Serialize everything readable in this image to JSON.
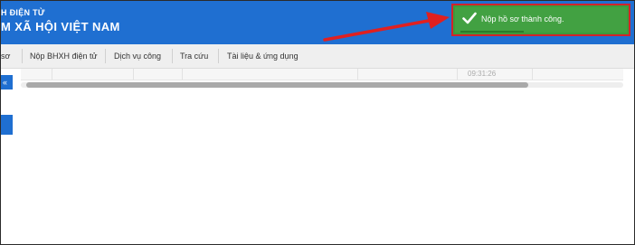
{
  "header": {
    "brand_line1": "H ĐIỆN TỬ",
    "brand_line2": "M XÃ HỘI VIỆT NAM"
  },
  "nav": {
    "items": [
      {
        "label": "sơ"
      },
      {
        "label": "Nộp BHXH điện tử"
      },
      {
        "label": "Dịch vụ công"
      },
      {
        "label": "Tra cứu"
      },
      {
        "label": "Tài liệu & ứng dụng"
      }
    ]
  },
  "table": {
    "time": "09:31:26"
  },
  "toast": {
    "message": "Nộp hồ sơ thành công.",
    "icon": "check-icon",
    "colors": {
      "background": "#42a142",
      "highlight_border": "#d2232a"
    }
  },
  "annotation": {
    "arrow_color": "#e02020"
  },
  "colors": {
    "brand": "#1f6fd1",
    "navbar": "#efefef"
  }
}
